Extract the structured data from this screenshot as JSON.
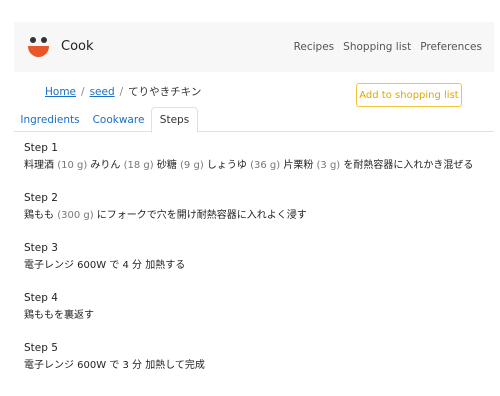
{
  "brand": {
    "name": "Cook"
  },
  "nav": {
    "links": [
      "Recipes",
      "Shopping list",
      "Preferences"
    ]
  },
  "breadcrumb": {
    "home": "Home",
    "seed": "seed",
    "current": "てりやきチキン",
    "separator": "/"
  },
  "actions": {
    "add_to_shopping_list": "Add to shopping list"
  },
  "tabs": [
    {
      "label": "Ingredients",
      "active": false
    },
    {
      "label": "Cookware",
      "active": false
    },
    {
      "label": "Steps",
      "active": true
    }
  ],
  "steps": [
    {
      "title": "Step 1",
      "parts": [
        {
          "t": "料理酒 "
        },
        {
          "t": "(10 g)",
          "q": true
        },
        {
          "t": " みりん "
        },
        {
          "t": "(18 g)",
          "q": true
        },
        {
          "t": " 砂糖 "
        },
        {
          "t": "(9 g)",
          "q": true
        },
        {
          "t": " しょうゆ "
        },
        {
          "t": "(36 g)",
          "q": true
        },
        {
          "t": " 片栗粉 "
        },
        {
          "t": "(3 g)",
          "q": true
        },
        {
          "t": " を耐熱容器に入れかき混ぜる"
        }
      ]
    },
    {
      "title": "Step 2",
      "parts": [
        {
          "t": "鶏もも "
        },
        {
          "t": "(300 g)",
          "q": true
        },
        {
          "t": " にフォークで穴を開け耐熱容器に入れよく浸す"
        }
      ]
    },
    {
      "title": "Step 3",
      "parts": [
        {
          "t": "電子レンジ 600W で 4 分 加熱する"
        }
      ]
    },
    {
      "title": "Step 4",
      "parts": [
        {
          "t": "鶏ももを裏返す"
        }
      ]
    },
    {
      "title": "Step 5",
      "parts": [
        {
          "t": "電子レンジ 600W で 3 分 加熱して完成"
        }
      ]
    }
  ],
  "colors": {
    "accent": "#1a6fc4",
    "warning": "#f0c73a",
    "logo_mouth": "#e8572a",
    "quantity": "#777777"
  }
}
